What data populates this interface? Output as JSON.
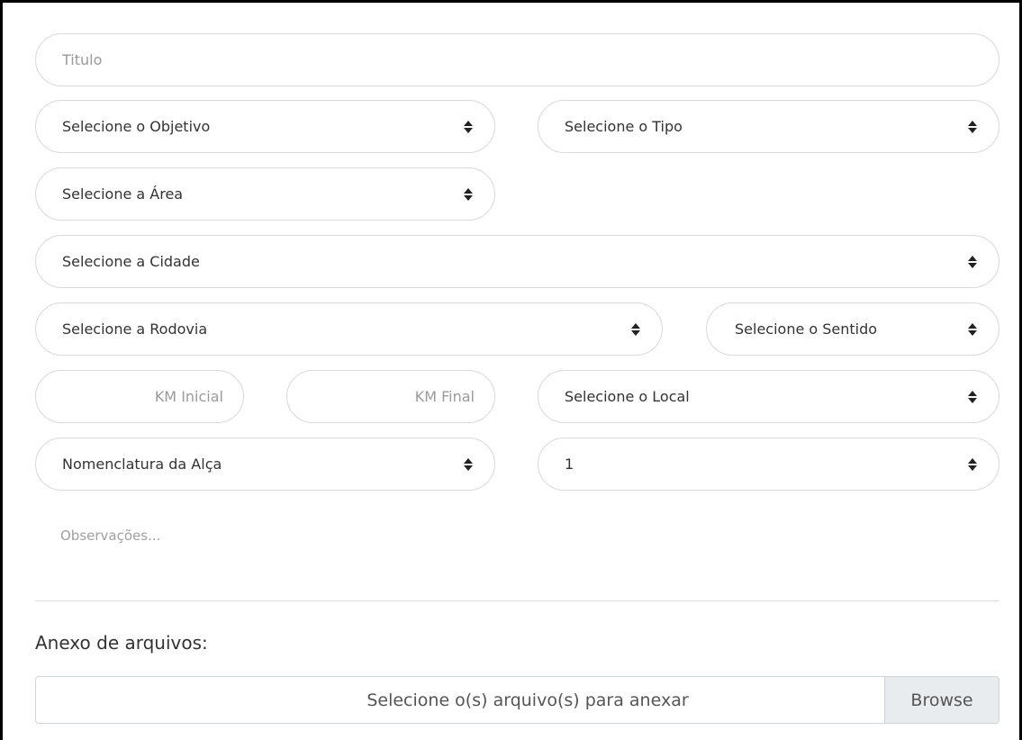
{
  "form": {
    "titulo_placeholder": "Titulo",
    "objetivo": "Selecione o Objetivo",
    "tipo": "Selecione o Tipo",
    "area": "Selecione a Área",
    "cidade": "Selecione a Cidade",
    "rodovia": "Selecione a Rodovia",
    "sentido": "Selecione o Sentido",
    "km_inicial_placeholder": "KM Inicial",
    "km_final_placeholder": "KM Final",
    "local": "Selecione o Local",
    "nomenclatura": "Nomenclatura da Alça",
    "quantidade": "1",
    "observacoes_placeholder": "Observações..."
  },
  "attachments": {
    "label": "Anexo de arquivos:",
    "file_placeholder": "Selecione o(s) arquivo(s) para anexar",
    "browse_label": "Browse"
  },
  "icons": {
    "select_caret": "sort-caret-icon"
  }
}
